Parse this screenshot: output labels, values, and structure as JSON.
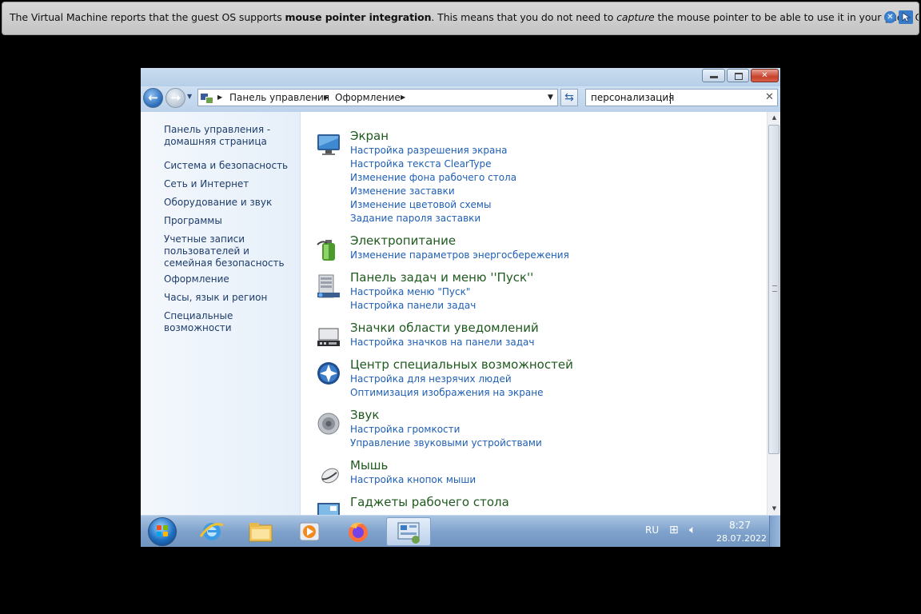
{
  "vbox_notice": {
    "t1": "The Virtual Machine reports that the guest OS supports ",
    "b1": "mouse pointer integration",
    "t2": ". This means that you do not need to ",
    "i1": "capture",
    "t3": " the mouse pointer to be able to use it in your guest OS --"
  },
  "explorer": {
    "breadcrumb": [
      "Панель управления",
      "Оформление"
    ],
    "search_value": "персонализация"
  },
  "sidebar": {
    "items": [
      "Панель управления - домашняя страница",
      "Система и безопасность",
      "Сеть и Интернет",
      "Оборудование и звук",
      "Программы",
      "Учетные записи пользователей и семейная безопасность",
      "Оформление",
      "Часы, язык и регион",
      "Специальные возможности"
    ]
  },
  "categories": [
    {
      "title": "Экран",
      "icon": "monitor-icon",
      "links": [
        "Настройка разрешения экрана",
        "Настройка текста ClearType",
        "Изменение фона рабочего стола",
        "Изменение заставки",
        "Изменение цветовой схемы",
        "Задание пароля заставки"
      ]
    },
    {
      "title": "Электропитание",
      "icon": "battery-icon",
      "links": [
        "Изменение параметров энергосбережения"
      ]
    },
    {
      "title": "Панель задач и меню ''Пуск''",
      "icon": "taskbar-icon",
      "links": [
        "Настройка меню \"Пуск\"",
        "Настройка панели задач"
      ]
    },
    {
      "title": "Значки области уведомлений",
      "icon": "notification-area-icon",
      "links": [
        "Настройка значков на панели задач"
      ]
    },
    {
      "title": "Центр специальных возможностей",
      "icon": "accessibility-icon",
      "links": [
        "Настройка для незрячих людей",
        "Оптимизация изображения на экране"
      ]
    },
    {
      "title": "Звук",
      "icon": "speaker-icon",
      "links": [
        "Настройка громкости",
        "Управление звуковыми устройствами"
      ]
    },
    {
      "title": "Мышь",
      "icon": "mouse-icon",
      "links": [
        "Настройка кнопок мыши"
      ]
    },
    {
      "title": "Гаджеты рабочего стола",
      "icon": "gadgets-icon",
      "links": []
    }
  ],
  "taskbar": {
    "lang": "RU",
    "time": "8:27",
    "date": "28.07.2022",
    "apps": [
      "start-orb",
      "internet-explorer-icon",
      "file-explorer-icon",
      "media-player-icon",
      "firefox-icon",
      "control-panel-icon"
    ]
  },
  "colors": {
    "link": "#1f5fb4",
    "category_title": "#1e5a1e",
    "sidebar_text": "#1e3d6b"
  }
}
